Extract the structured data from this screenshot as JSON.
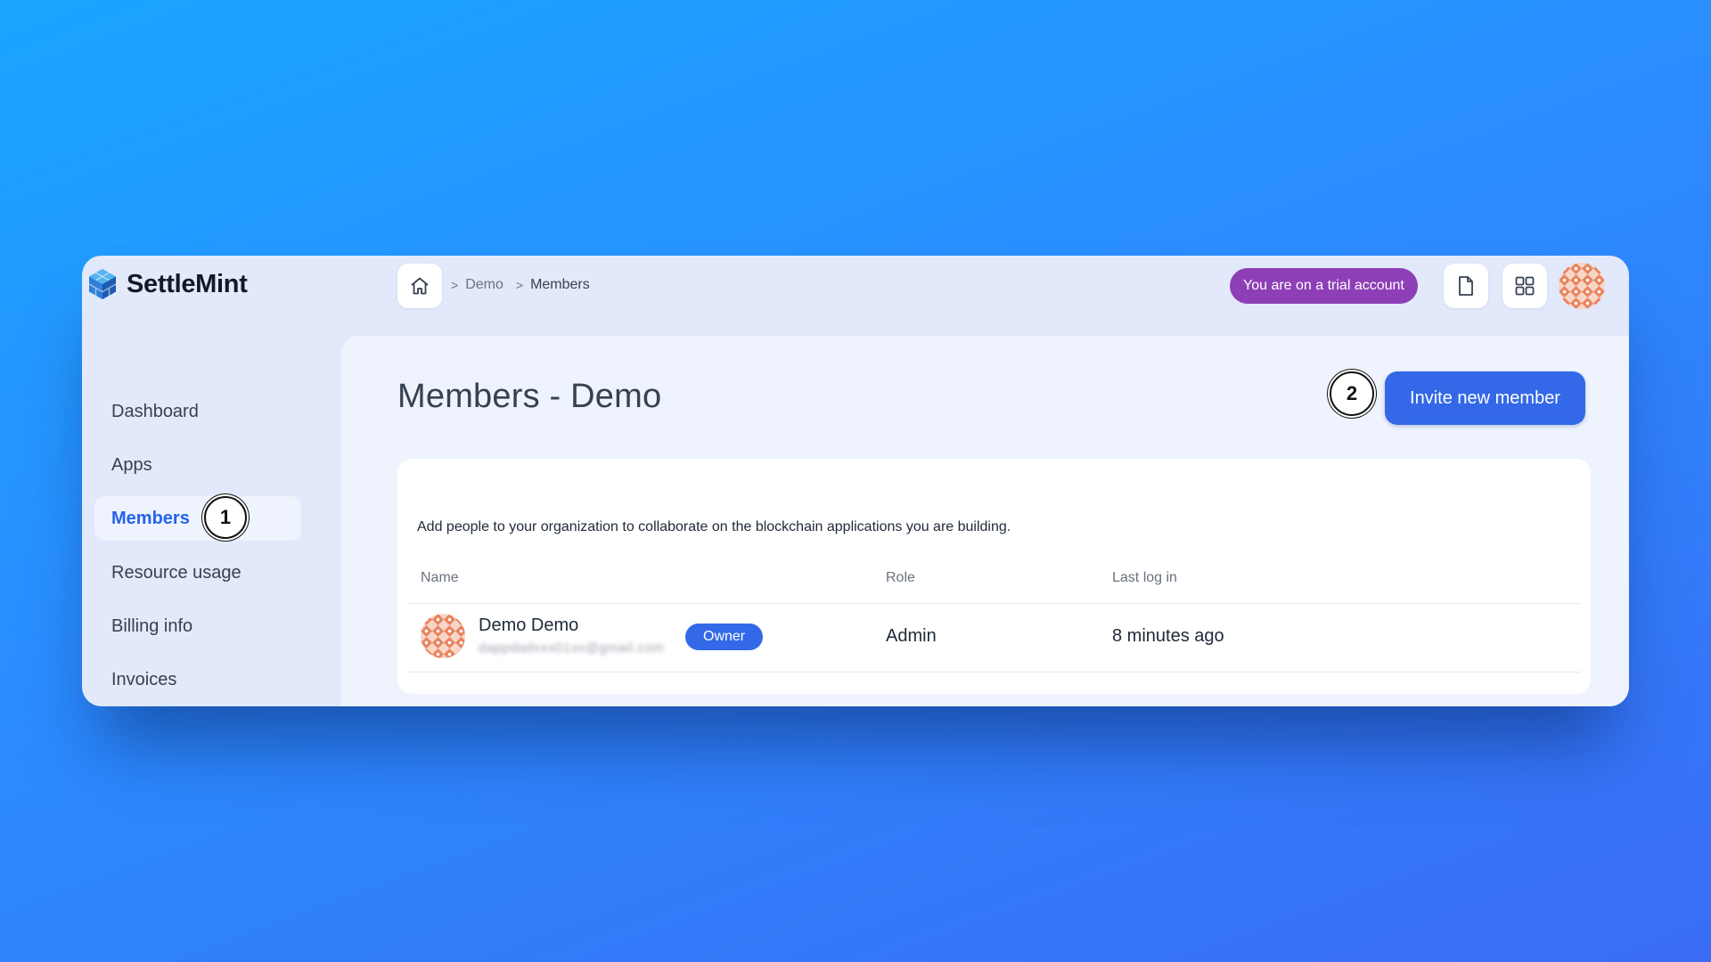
{
  "brand": {
    "name": "SettleMint"
  },
  "breadcrumb": {
    "separator": ">",
    "items": [
      "Demo",
      "Members"
    ]
  },
  "header": {
    "trial_badge": "You are on a trial account",
    "icons": [
      "home-icon",
      "document-icon",
      "apps-grid-icon",
      "user-avatar"
    ]
  },
  "sidebar": {
    "items": [
      {
        "label": "Dashboard",
        "active": false
      },
      {
        "label": "Apps",
        "active": false
      },
      {
        "label": "Members",
        "active": true
      },
      {
        "label": "Resource usage",
        "active": false
      },
      {
        "label": "Billing info",
        "active": false
      },
      {
        "label": "Invoices",
        "active": false
      }
    ]
  },
  "annotations": {
    "step1": "1",
    "step2": "2"
  },
  "main": {
    "title": "Members - Demo",
    "invite_button": "Invite new member",
    "description": "Add people to your organization to collaborate on the blockchain applications you are building.",
    "table": {
      "headers": {
        "name": "Name",
        "role": "Role",
        "last_login": "Last log in"
      },
      "rows": [
        {
          "name": "Demo Demo",
          "email": "dappdadxxx01xx@gmail.com",
          "badge": "Owner",
          "role": "Admin",
          "last_login": "8 minutes ago"
        }
      ]
    }
  },
  "colors": {
    "accent": "#3369e8",
    "trial_badge": "#8e3fb7",
    "active_nav": "#2563eb",
    "avatar_pattern": "#e8845f"
  }
}
